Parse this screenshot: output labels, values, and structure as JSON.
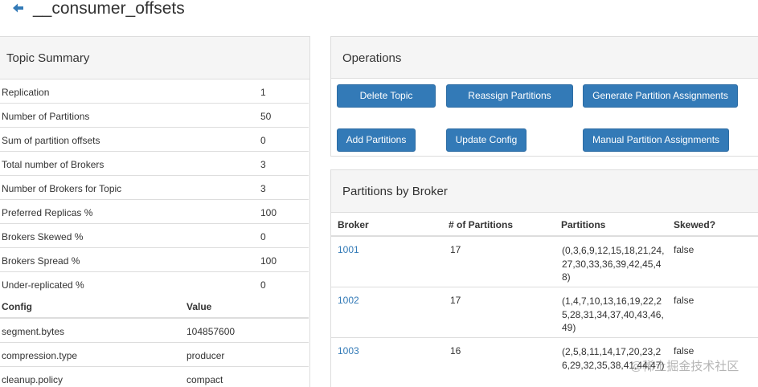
{
  "header": {
    "title": "__consumer_offsets"
  },
  "topic_summary": {
    "heading": "Topic Summary",
    "rows": [
      {
        "label": "Replication",
        "value": "1"
      },
      {
        "label": "Number of Partitions",
        "value": "50"
      },
      {
        "label": "Sum of partition offsets",
        "value": "0"
      },
      {
        "label": "Total number of Brokers",
        "value": "3"
      },
      {
        "label": "Number of Brokers for Topic",
        "value": "3"
      },
      {
        "label": "Preferred Replicas %",
        "value": "100"
      },
      {
        "label": "Brokers Skewed %",
        "value": "0"
      },
      {
        "label": "Brokers Spread %",
        "value": "100"
      },
      {
        "label": "Under-replicated %",
        "value": "0"
      }
    ],
    "config_header": {
      "key": "Config",
      "value": "Value"
    },
    "config_rows": [
      {
        "key": "segment.bytes",
        "value": "104857600"
      },
      {
        "key": "compression.type",
        "value": "producer"
      },
      {
        "key": "cleanup.policy",
        "value": "compact"
      }
    ]
  },
  "operations": {
    "heading": "Operations",
    "buttons": {
      "delete_topic": "Delete Topic",
      "reassign_partitions": "Reassign Partitions",
      "generate_assignments": "Generate Partition Assignments",
      "add_partitions": "Add Partitions",
      "update_config": "Update Config",
      "manual_assignments": "Manual Partition Assignments"
    }
  },
  "partitions_by_broker": {
    "heading": "Partitions by Broker",
    "columns": {
      "broker": "Broker",
      "count": "# of Partitions",
      "partitions": "Partitions",
      "skewed": "Skewed?"
    },
    "rows": [
      {
        "broker": "1001",
        "count": "17",
        "partitions": "(0,3,6,9,12,15,18,21,24,27,30,33,36,39,42,45,48)",
        "skewed": "false"
      },
      {
        "broker": "1002",
        "count": "17",
        "partitions": "(1,4,7,10,13,16,19,22,25,28,31,34,37,40,43,46,49)",
        "skewed": "false"
      },
      {
        "broker": "1003",
        "count": "16",
        "partitions": "(2,5,8,11,14,17,20,23,26,29,32,35,38,41,44,47)",
        "skewed": "false"
      }
    ]
  },
  "watermark": "@稀土掘金技术社区",
  "colors": {
    "primary": "#337ab7",
    "link": "#337ab7",
    "heading_bg": "#f5f5f5",
    "border": "#dddddd"
  }
}
